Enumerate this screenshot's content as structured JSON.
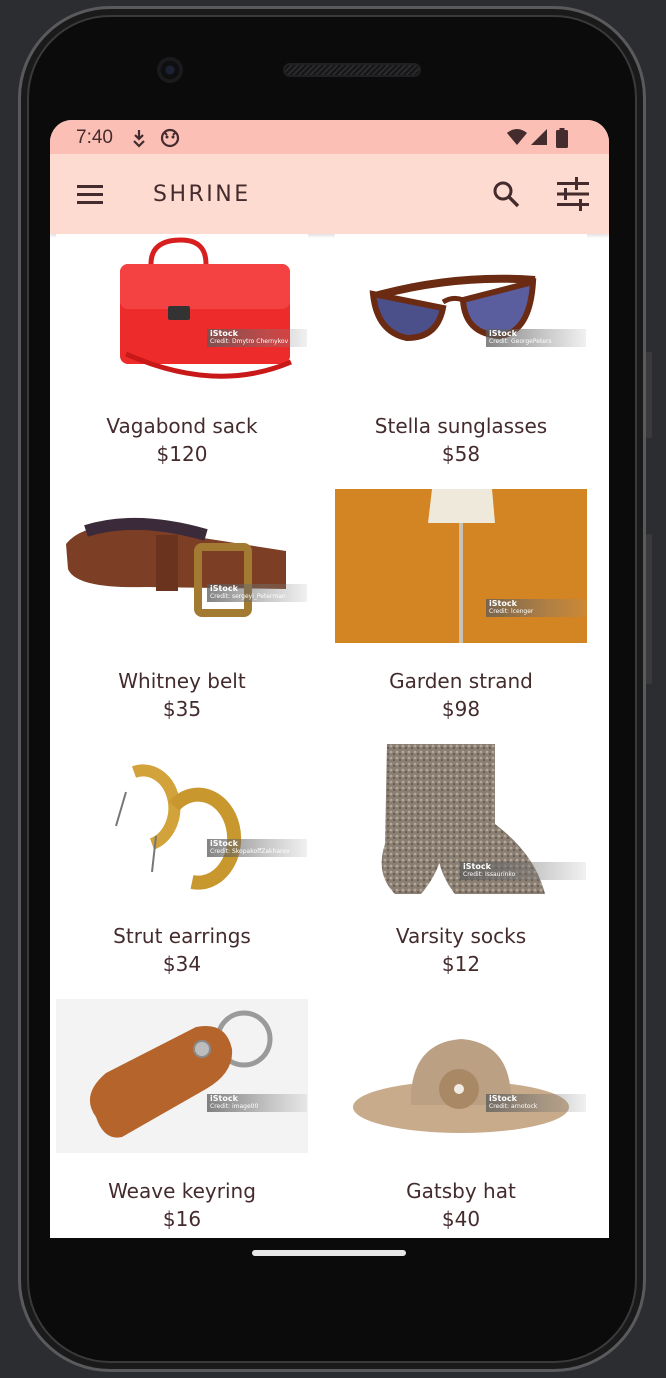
{
  "status_bar": {
    "time": "7:40"
  },
  "app_bar": {
    "title": "SHRINE",
    "menu_icon": "menu-icon",
    "search_icon": "search-icon",
    "filter_icon": "tune-icon"
  },
  "colors": {
    "status_bar": "#fbbfb5",
    "app_bar": "#fedbd0",
    "text": "#442b2d"
  },
  "products": [
    {
      "name": "Vagabond sack",
      "price": "$120",
      "watermark_brand": "iStock",
      "watermark_credit": "Credit: Dmytro Chernykov"
    },
    {
      "name": "Stella sunglasses",
      "price": "$58",
      "watermark_brand": "iStock",
      "watermark_credit": "Credit: GeorgePeters"
    },
    {
      "name": "Whitney belt",
      "price": "$35",
      "watermark_brand": "iStock",
      "watermark_credit": "Credit: sergeyi_Peterman"
    },
    {
      "name": "Garden strand",
      "price": "$98",
      "watermark_brand": "iStock",
      "watermark_credit": "Credit: lcenger"
    },
    {
      "name": "Strut earrings",
      "price": "$34",
      "watermark_brand": "iStock",
      "watermark_credit": "Credit: SkopakoffZakharov"
    },
    {
      "name": "Varsity socks",
      "price": "$12",
      "watermark_brand": "iStock",
      "watermark_credit": "Credit: Issaurinko"
    },
    {
      "name": "Weave keyring",
      "price": "$16",
      "watermark_brand": "iStock",
      "watermark_credit": "Credit: image00"
    },
    {
      "name": "Gatsby hat",
      "price": "$40",
      "watermark_brand": "iStock",
      "watermark_credit": "Credit: arnotock"
    }
  ]
}
